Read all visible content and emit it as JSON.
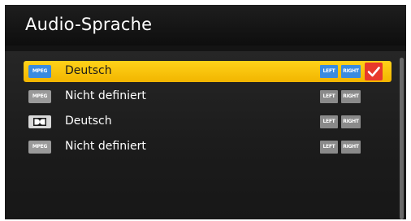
{
  "window": {
    "title": "Audio-Sprache"
  },
  "audio_tracks": [
    {
      "format": "MPEG",
      "format_icon": "mpeg-icon",
      "language": "Deutsch",
      "left": "LEFT",
      "right": "RIGHT",
      "selected": true,
      "checked": true
    },
    {
      "format": "MPEG",
      "format_icon": "mpeg-icon",
      "language": "Nicht definiert",
      "left": "LEFT",
      "right": "RIGHT",
      "selected": false,
      "checked": false
    },
    {
      "format": "DD",
      "format_icon": "dolby-digital-icon",
      "language": "Deutsch",
      "left": "LEFT",
      "right": "RIGHT",
      "selected": false,
      "checked": false
    },
    {
      "format": "MPEG",
      "format_icon": "mpeg-icon",
      "language": "Nicht definiert",
      "left": "LEFT",
      "right": "RIGHT",
      "selected": false,
      "checked": false
    }
  ],
  "colors": {
    "highlight": "#f5c000",
    "channel_active": "#3a8be0",
    "check": "#e8392c",
    "background": "#141414"
  }
}
